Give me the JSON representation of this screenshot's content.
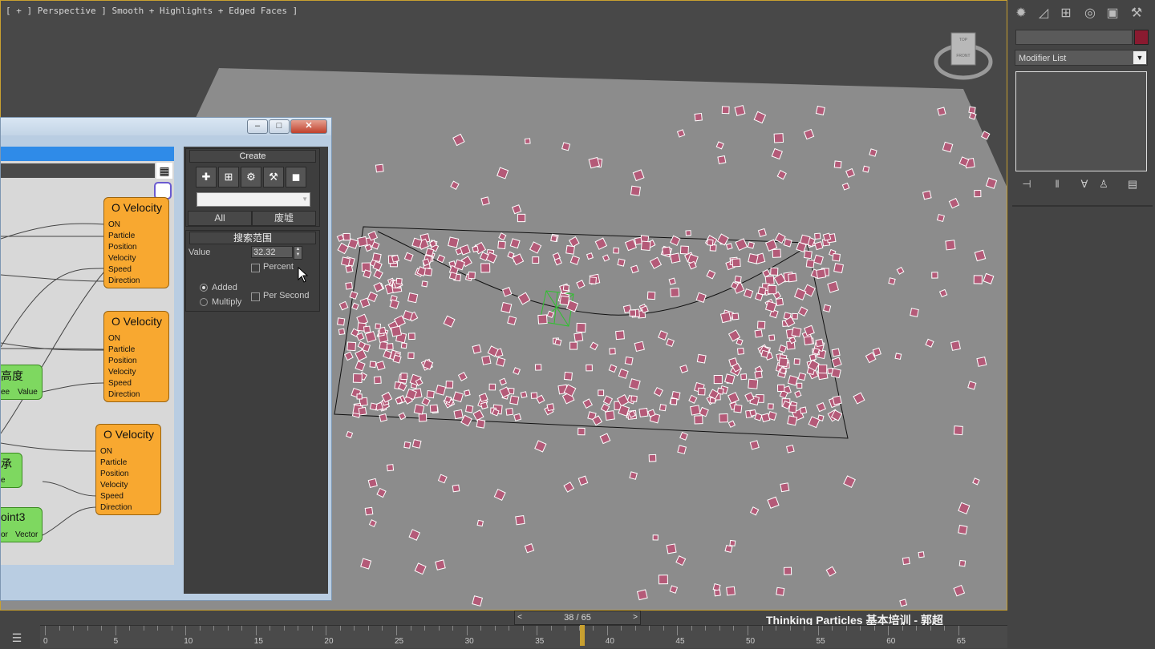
{
  "viewport": {
    "label": "[ + ] Perspective ] Smooth + Highlights + Edged Faces ]",
    "viewcube_top": "TOP",
    "viewcube_front": "FRONT"
  },
  "command_panel": {
    "tabs": [
      "create-icon",
      "modify-icon",
      "hierarchy-icon",
      "motion-icon",
      "display-icon",
      "utilities-icon"
    ],
    "object_color": "#8a1a30",
    "modifier_list": "Modifier List"
  },
  "node_graph": {
    "nodes": [
      {
        "title": "O Velocity",
        "ports": [
          "ON",
          "Particle",
          "Position",
          "Velocity",
          "Speed",
          "Direction"
        ]
      },
      {
        "title": "O Velocity",
        "ports": [
          "ON",
          "Particle",
          "Position",
          "Velocity",
          "Speed",
          "Direction"
        ]
      },
      {
        "title": "O Velocity",
        "ports": [
          "ON",
          "Particle",
          "Position",
          "Velocity",
          "Speed",
          "Direction"
        ]
      }
    ],
    "green_nodes": [
      {
        "title": "高度",
        "ports": [
          "ee",
          "Value"
        ]
      },
      {
        "title": "承",
        "ports": [
          "e"
        ]
      },
      {
        "title": "oint3",
        "ports": [
          "or",
          "Vector"
        ]
      }
    ]
  },
  "create_rollout": {
    "title": "Create",
    "all_button": "All",
    "ruins_button": "废墟"
  },
  "search_rollout": {
    "title": "搜索范围",
    "value_label": "Value",
    "value": "32.32",
    "percent_label": "Percent",
    "added_label": "Added",
    "multiply_label": "Multiply",
    "per_second_label": "Per Second"
  },
  "timeline": {
    "frame_display": "38 / 65",
    "caption": "Thinking Particles 基本培训 - 郭超",
    "ticks": [
      "0",
      "5",
      "10",
      "15",
      "20",
      "25",
      "30",
      "35",
      "40",
      "45",
      "50",
      "55",
      "60",
      "65"
    ]
  }
}
